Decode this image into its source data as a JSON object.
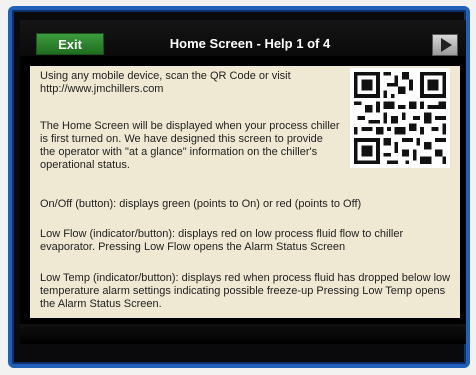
{
  "header": {
    "exit_label": "Exit",
    "title": "Home Screen - Help 1 of 4"
  },
  "icons": {
    "next": "play-arrow-icon",
    "qr": "qr-code-icon"
  },
  "colors": {
    "bezel": "#2060b8",
    "exit_button": "#2f852f",
    "content_background": "#efe8d2"
  },
  "help": {
    "paragraphs": [
      "Using any mobile device, scan the QR Code or visit http://www.jmchillers.com",
      "The Home Screen will be displayed when your process chiller is first turned on. We have designed this screen to provide the operator with \"at a glance\" information on the chiller's operational status.",
      "On/Off (button): displays green (points to On) or red (points to Off)",
      "Low Flow (indicator/button):  displays red on low process fluid flow to chiller evaporator.  Pressing Low Flow opens the Alarm Status Screen",
      "Low Temp (indicator/button): displays red when process fluid has dropped below low temperature alarm settings indicating possible freeze-up Pressing Low Temp opens the Alarm Status Screen."
    ]
  }
}
